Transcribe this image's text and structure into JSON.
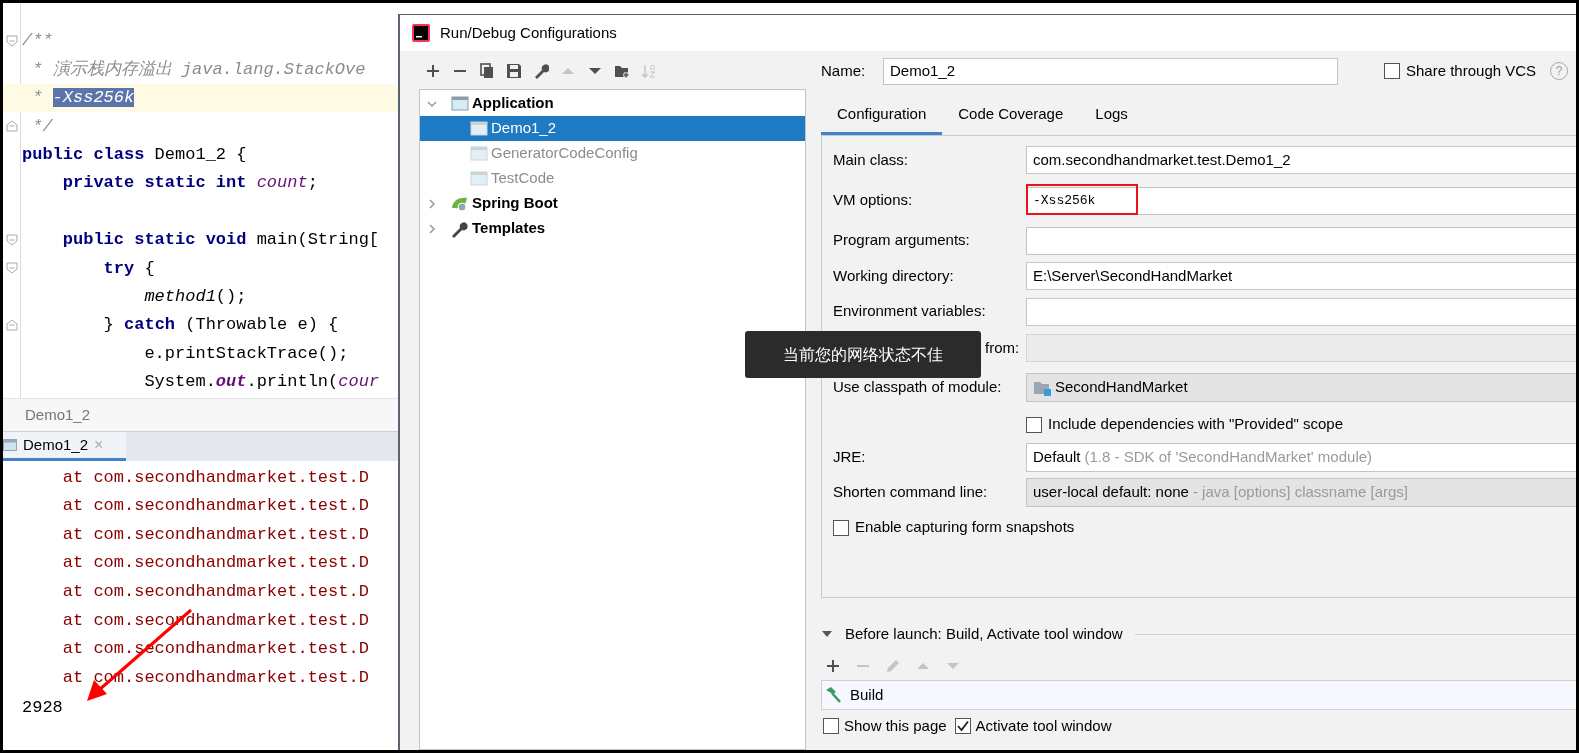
{
  "editor": {
    "lines": [
      {
        "current": false,
        "fold_open": true,
        "segments": [
          {
            "kind": "comment",
            "text": "/**"
          }
        ]
      },
      {
        "current": false,
        "segments": [
          {
            "kind": "comment",
            "text": " * 演示栈内存溢出 java.lang.StackOve"
          }
        ]
      },
      {
        "current": true,
        "segments": [
          {
            "kind": "comment",
            "text": " * "
          },
          {
            "kind": "selection",
            "text": "-Xss256k"
          }
        ]
      },
      {
        "current": false,
        "fold_close": true,
        "segments": [
          {
            "kind": "comment",
            "text": " */"
          }
        ]
      },
      {
        "current": false,
        "segments": [
          {
            "kind": "keyword",
            "text": "public class"
          },
          {
            "kind": "plain",
            "text": " Demo1_2 {"
          }
        ]
      },
      {
        "current": false,
        "segments": [
          {
            "kind": "keyword",
            "text": "    private static int "
          },
          {
            "kind": "field",
            "text": "count"
          },
          {
            "kind": "plain",
            "text": ";"
          }
        ]
      },
      {
        "current": false,
        "fold_open": true,
        "blank_line_before": true,
        "segments": [
          {
            "kind": "keyword",
            "text": "    public static void"
          },
          {
            "kind": "plain",
            "text": " main(String["
          }
        ]
      },
      {
        "current": false,
        "fold_open": true,
        "segments": [
          {
            "kind": "keyword",
            "text": "        try"
          },
          {
            "kind": "plain",
            "text": " {"
          }
        ]
      },
      {
        "current": false,
        "segments": [
          {
            "kind": "call",
            "text": "            method1"
          },
          {
            "kind": "plain",
            "text": "();"
          }
        ]
      },
      {
        "current": false,
        "fold_close": true,
        "segments": [
          {
            "kind": "plain",
            "text": "        } "
          },
          {
            "kind": "keyword",
            "text": "catch"
          },
          {
            "kind": "plain",
            "text": " (Throwable e) {"
          }
        ]
      },
      {
        "current": false,
        "segments": [
          {
            "kind": "plain",
            "text": "            e.printStackTrace();"
          }
        ]
      },
      {
        "current": false,
        "segments": [
          {
            "kind": "plain",
            "text": "            System."
          },
          {
            "kind": "static",
            "text": "out"
          },
          {
            "kind": "plain",
            "text": ".println("
          },
          {
            "kind": "field",
            "text": "cour"
          }
        ]
      }
    ],
    "breadcrumb": "Demo1_2",
    "run_tab": {
      "label": "Demo1_2",
      "close": "×",
      "selected": true
    },
    "console": [
      {
        "kind": "error",
        "text": "    at com.secondhandmarket.test.D"
      },
      {
        "kind": "error",
        "text": "    at com.secondhandmarket.test.D"
      },
      {
        "kind": "error",
        "text": "    at com.secondhandmarket.test.D"
      },
      {
        "kind": "error",
        "text": "    at com.secondhandmarket.test.D"
      },
      {
        "kind": "error",
        "text": "    at com.secondhandmarket.test.D"
      },
      {
        "kind": "error",
        "text": "    at com.secondhandmarket.test.D"
      },
      {
        "kind": "error",
        "text": "    at com.secondhandmarket.test.D"
      },
      {
        "kind": "error",
        "text": "    at com.secondhandmarket.test.D"
      },
      {
        "kind": "output",
        "text": "2928"
      }
    ]
  },
  "dialog": {
    "title": "Run/Debug Configurations",
    "toolbar": [
      {
        "kind": "add",
        "disabled": false
      },
      {
        "kind": "remove",
        "disabled": false
      },
      {
        "kind": "copy",
        "disabled": false
      },
      {
        "kind": "save",
        "disabled": false
      },
      {
        "kind": "wrench",
        "disabled": false
      },
      {
        "kind": "up",
        "disabled": true
      },
      {
        "kind": "down",
        "disabled": false
      },
      {
        "kind": "folder",
        "disabled": false
      },
      {
        "kind": "sort",
        "disabled": true
      }
    ],
    "tree": [
      {
        "label": "Application",
        "kind": "app",
        "expanded": true,
        "selected": false,
        "children": [
          {
            "label": "Demo1_2",
            "kind": "config",
            "selected": true
          },
          {
            "label": "GeneratorCodeConfig",
            "kind": "config",
            "selected": false
          },
          {
            "label": "TestCode",
            "kind": "config",
            "selected": false
          }
        ]
      },
      {
        "label": "Spring Boot",
        "kind": "spring",
        "expanded": false,
        "selected": false
      },
      {
        "label": "Templates",
        "kind": "templates",
        "expanded": false,
        "selected": false
      }
    ],
    "name_label": "Name:",
    "name_value": "Demo1_2",
    "share": {
      "label": "Share through VCS",
      "checked": false
    },
    "help": "?",
    "tabs": [
      {
        "label": "Configuration",
        "selected": true
      },
      {
        "label": "Code Coverage",
        "selected": false
      },
      {
        "label": "Logs",
        "selected": false
      }
    ],
    "rows": [
      {
        "kind": "field",
        "label": "Main class:",
        "value": "com.secondhandmarket.test.Demo1_2",
        "disabled": false
      },
      {
        "kind": "field",
        "label": "VM options:",
        "value": "-Xss256k",
        "mono": true,
        "highlighted": true,
        "disabled": false
      },
      {
        "kind": "field",
        "label": "Program arguments:",
        "disabled": false
      },
      {
        "kind": "field",
        "label": "Working directory:",
        "value": "E:\\Server\\SecondHandMarket",
        "disabled": false
      },
      {
        "kind": "field",
        "label": "Environment variables:",
        "disabled": false
      },
      {
        "kind": "field",
        "label": "from:",
        "disabled": true
      },
      {
        "kind": "combo",
        "label": "Use classpath of module:",
        "value": "SecondHandMarket",
        "module_icon": true
      },
      {
        "kind": "checkbox",
        "label": "Include dependencies with \"Provided\" scope",
        "checked": false,
        "indented": true
      },
      {
        "kind": "editable_combo",
        "label": "JRE:",
        "value": "Default",
        "hint": "(1.8 - SDK of 'SecondHandMarket' module)"
      },
      {
        "kind": "combo",
        "label": "Shorten command line:",
        "value": "user-local default: none",
        "hint": "- java [options] classname [args]"
      },
      {
        "kind": "checkbox",
        "label": "Enable capturing form snapshots",
        "checked": false,
        "indented": false
      }
    ],
    "before_launch": {
      "label": "Before launch: Build, Activate tool window",
      "expanded": true,
      "toolbar": [
        {
          "kind": "add",
          "disabled": false
        },
        {
          "kind": "remove",
          "disabled": true
        },
        {
          "kind": "edit",
          "disabled": true
        },
        {
          "kind": "up",
          "disabled": true
        },
        {
          "kind": "down",
          "disabled": true
        }
      ],
      "tasks": [
        {
          "label": "Build"
        }
      ]
    },
    "bottom_checks": [
      {
        "label": "Show this page",
        "checked": false
      },
      {
        "label": "Activate tool window",
        "checked": true
      }
    ]
  },
  "toast": "当前您的网络状态不佳"
}
